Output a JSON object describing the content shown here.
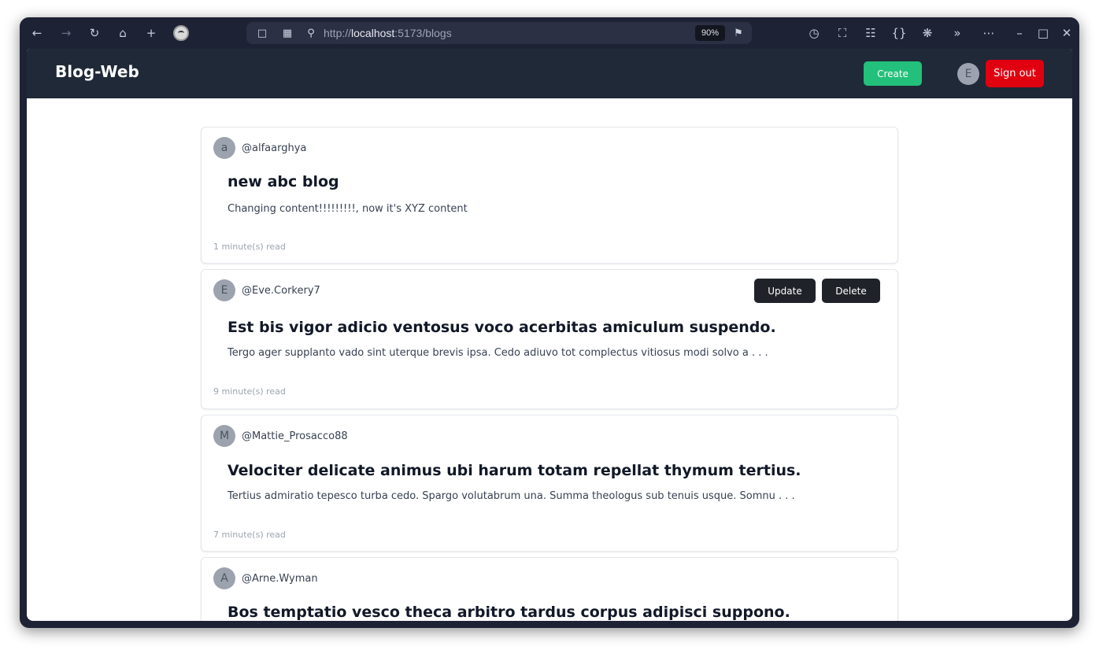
{
  "browser": {
    "url_scheme": "http://",
    "url_host": "localhost",
    "url_path": ":5173/blogs",
    "zoom": "90%"
  },
  "app": {
    "brand": "Blog-Web",
    "create_label": "Create",
    "user_initial": "E",
    "signout_label": "Sign out"
  },
  "posts": [
    {
      "initial": "a",
      "handle": "@alfaarghya",
      "title": "new abc blog",
      "excerpt": "Changing content!!!!!!!!!, now it's XYZ content",
      "readtime": "1 minute(s) read"
    },
    {
      "initial": "E",
      "handle": "@Eve.Corkery7",
      "title": "Est bis vigor adicio ventosus voco acerbitas amiculum suspendo.",
      "excerpt": "Tergo ager supplanto vado sint uterque brevis ipsa. Cedo adiuvo tot complectus vitiosus modi solvo a . . .",
      "readtime": "9 minute(s) read",
      "update_label": "Update",
      "delete_label": "Delete"
    },
    {
      "initial": "M",
      "handle": "@Mattie_Prosacco88",
      "title": "Velociter delicate animus ubi harum totam repellat thymum tertius.",
      "excerpt": "Tertius admiratio tepesco turba cedo. Spargo volutabrum una. Summa theologus sub tenuis usque. Somnu . . .",
      "readtime": "7 minute(s) read"
    },
    {
      "initial": "A",
      "handle": "@Arne.Wyman",
      "title": "Bos temptatio vesco theca arbitro tardus corpus adipisci suppono."
    }
  ]
}
